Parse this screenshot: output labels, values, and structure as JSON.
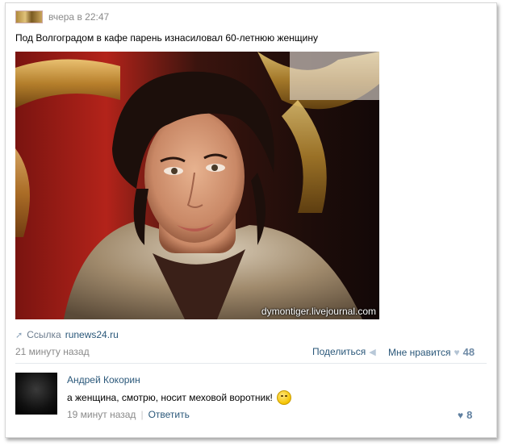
{
  "post": {
    "time": "вчера в 22:47",
    "text": "Под Волгоградом в кафе парень изнасиловал 60-летнюю женщину",
    "watermark": "dymontiger.livejournal.com",
    "link_prefix": "Ссылка",
    "link_text": "runews24.ru",
    "footer_time": "21 минуту назад",
    "share_label": "Поделиться",
    "like_label": "Мне нравится",
    "like_count": "48"
  },
  "comment": {
    "author": "Андрей Кокорин",
    "text": "а женщина, смотрю, носит меховой воротник!",
    "time": "19 минут назад",
    "separator": "|",
    "reply_label": "Ответить",
    "like_count": "8"
  },
  "icons": {
    "link": "link-arrow-icon",
    "share": "megaphone-icon",
    "like": "heart-icon",
    "emoji": "smiley-icon"
  },
  "colors": {
    "link": "#2b587a",
    "muted": "#8a8a8a",
    "like_count": "#6f8ba6"
  }
}
